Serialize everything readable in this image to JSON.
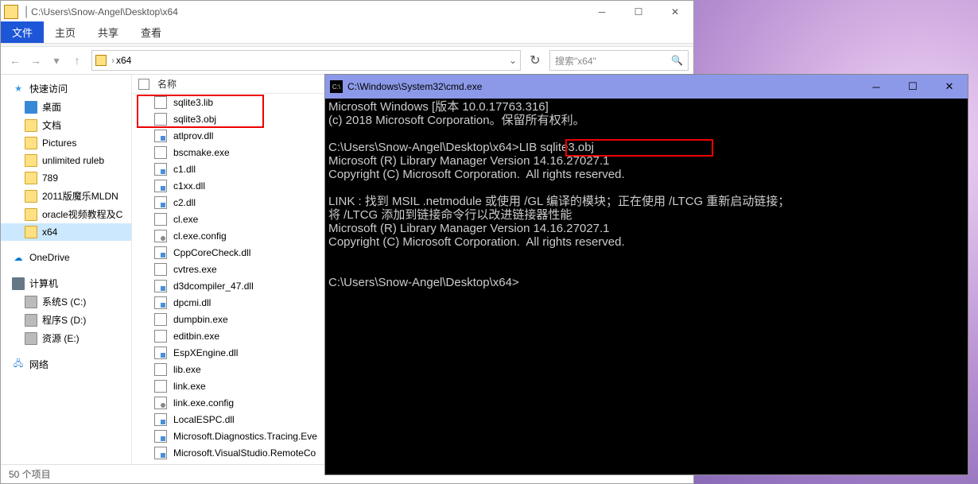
{
  "explorer": {
    "title_path": "C:\\Users\\Snow-Angel\\Desktop\\x64",
    "tabs": {
      "file": "文件",
      "home": "主页",
      "share": "共享",
      "view": "查看"
    },
    "address_current": "x64",
    "search_placeholder": "搜索\"x64\"",
    "nav": {
      "quick": "快速访问",
      "desktop": "桌面",
      "docs": "文档",
      "pics": "Pictures",
      "unlimited": "unlimited ruleb",
      "n789": "789",
      "mldn": "2011版魔乐MLDN",
      "oracle": "oracle视频教程及C",
      "x64": "x64",
      "onedrive": "OneDrive",
      "computer": "计算机",
      "sysc": "系统S (C:)",
      "progd": "程序S (D:)",
      "rese": "资源 (E:)",
      "network": "网络"
    },
    "col_name": "名称",
    "files": [
      {
        "icon": "lib",
        "name": "sqlite3.lib"
      },
      {
        "icon": "obj",
        "name": "sqlite3.obj"
      },
      {
        "icon": "dll",
        "name": "atlprov.dll"
      },
      {
        "icon": "exe",
        "name": "bscmake.exe"
      },
      {
        "icon": "dll",
        "name": "c1.dll"
      },
      {
        "icon": "dll",
        "name": "c1xx.dll"
      },
      {
        "icon": "dll",
        "name": "c2.dll"
      },
      {
        "icon": "exe",
        "name": "cl.exe"
      },
      {
        "icon": "cfg",
        "name": "cl.exe.config"
      },
      {
        "icon": "dll",
        "name": "CppCoreCheck.dll"
      },
      {
        "icon": "exe",
        "name": "cvtres.exe"
      },
      {
        "icon": "dll",
        "name": "d3dcompiler_47.dll"
      },
      {
        "icon": "dll",
        "name": "dpcmi.dll"
      },
      {
        "icon": "exe",
        "name": "dumpbin.exe"
      },
      {
        "icon": "exe",
        "name": "editbin.exe"
      },
      {
        "icon": "dll",
        "name": "EspXEngine.dll"
      },
      {
        "icon": "exe",
        "name": "lib.exe"
      },
      {
        "icon": "exe",
        "name": "link.exe"
      },
      {
        "icon": "cfg",
        "name": "link.exe.config"
      },
      {
        "icon": "dll",
        "name": "LocalESPC.dll"
      },
      {
        "icon": "dll",
        "name": "Microsoft.Diagnostics.Tracing.Eve"
      },
      {
        "icon": "dll",
        "name": "Microsoft.VisualStudio.RemoteCo"
      }
    ],
    "status": "50 个项目"
  },
  "cmd": {
    "title": "C:\\Windows\\System32\\cmd.exe",
    "lines": [
      "Microsoft Windows [版本 10.0.17763.316]",
      "(c) 2018 Microsoft Corporation。保留所有权利。",
      "",
      "C:\\Users\\Snow-Angel\\Desktop\\x64>LIB sqlite3.obj",
      "Microsoft (R) Library Manager Version 14.16.27027.1",
      "Copyright (C) Microsoft Corporation.  All rights reserved.",
      "",
      "LINK : 找到 MSIL .netmodule 或使用 /GL 编译的模块；正在使用 /LTCG 重新启动链接；",
      "将 /LTCG 添加到链接命令行以改进链接器性能",
      "Microsoft (R) Library Manager Version 14.16.27027.1",
      "Copyright (C) Microsoft Corporation.  All rights reserved.",
      "",
      "",
      "C:\\Users\\Snow-Angel\\Desktop\\x64>"
    ]
  }
}
